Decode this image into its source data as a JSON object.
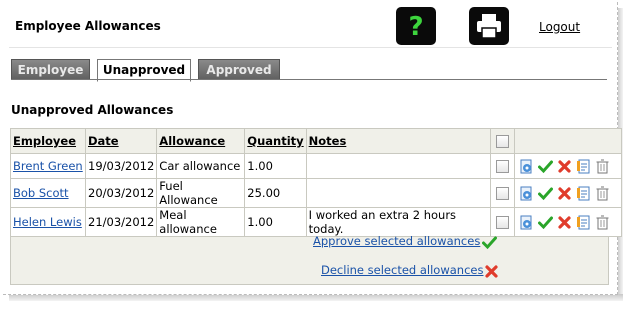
{
  "header": {
    "title": "Employee Allowances",
    "help_icon": "help-question-icon",
    "print_icon": "printer-icon",
    "logout_label": "Logout"
  },
  "tabs": [
    {
      "label": "Employee",
      "active": false
    },
    {
      "label": "Unapproved",
      "active": true
    },
    {
      "label": "Approved",
      "active": false
    }
  ],
  "section_title": "Unapproved Allowances",
  "table": {
    "headers": {
      "employee": "Employee",
      "date": "Date",
      "allowance": "Allowance",
      "quantity": "Quantity",
      "notes": "Notes"
    },
    "rows": [
      {
        "employee": "Brent Green",
        "date": "19/03/2012",
        "allowance": "Car allowance",
        "quantity": "1.00",
        "notes": ""
      },
      {
        "employee": "Bob Scott",
        "date": "20/03/2012",
        "allowance": "Fuel Allowance",
        "quantity": "25.00",
        "notes": ""
      },
      {
        "employee": "Helen Lewis",
        "date": "21/03/2012",
        "allowance": "Meal allowance",
        "quantity": "1.00",
        "notes": "I worked an extra 2 hours today."
      }
    ],
    "row_action_icons": [
      "edit-icon",
      "approve-check-icon",
      "decline-x-icon",
      "notes-icon",
      "delete-trash-icon"
    ]
  },
  "bulk_actions": {
    "approve_label": "Approve selected allowances",
    "decline_label": "Decline selected allowances"
  },
  "colors": {
    "link": "#1a52a8",
    "approve": "#2aa52a",
    "decline": "#e03c2c",
    "table_header_bg": "#f0f0e9"
  }
}
